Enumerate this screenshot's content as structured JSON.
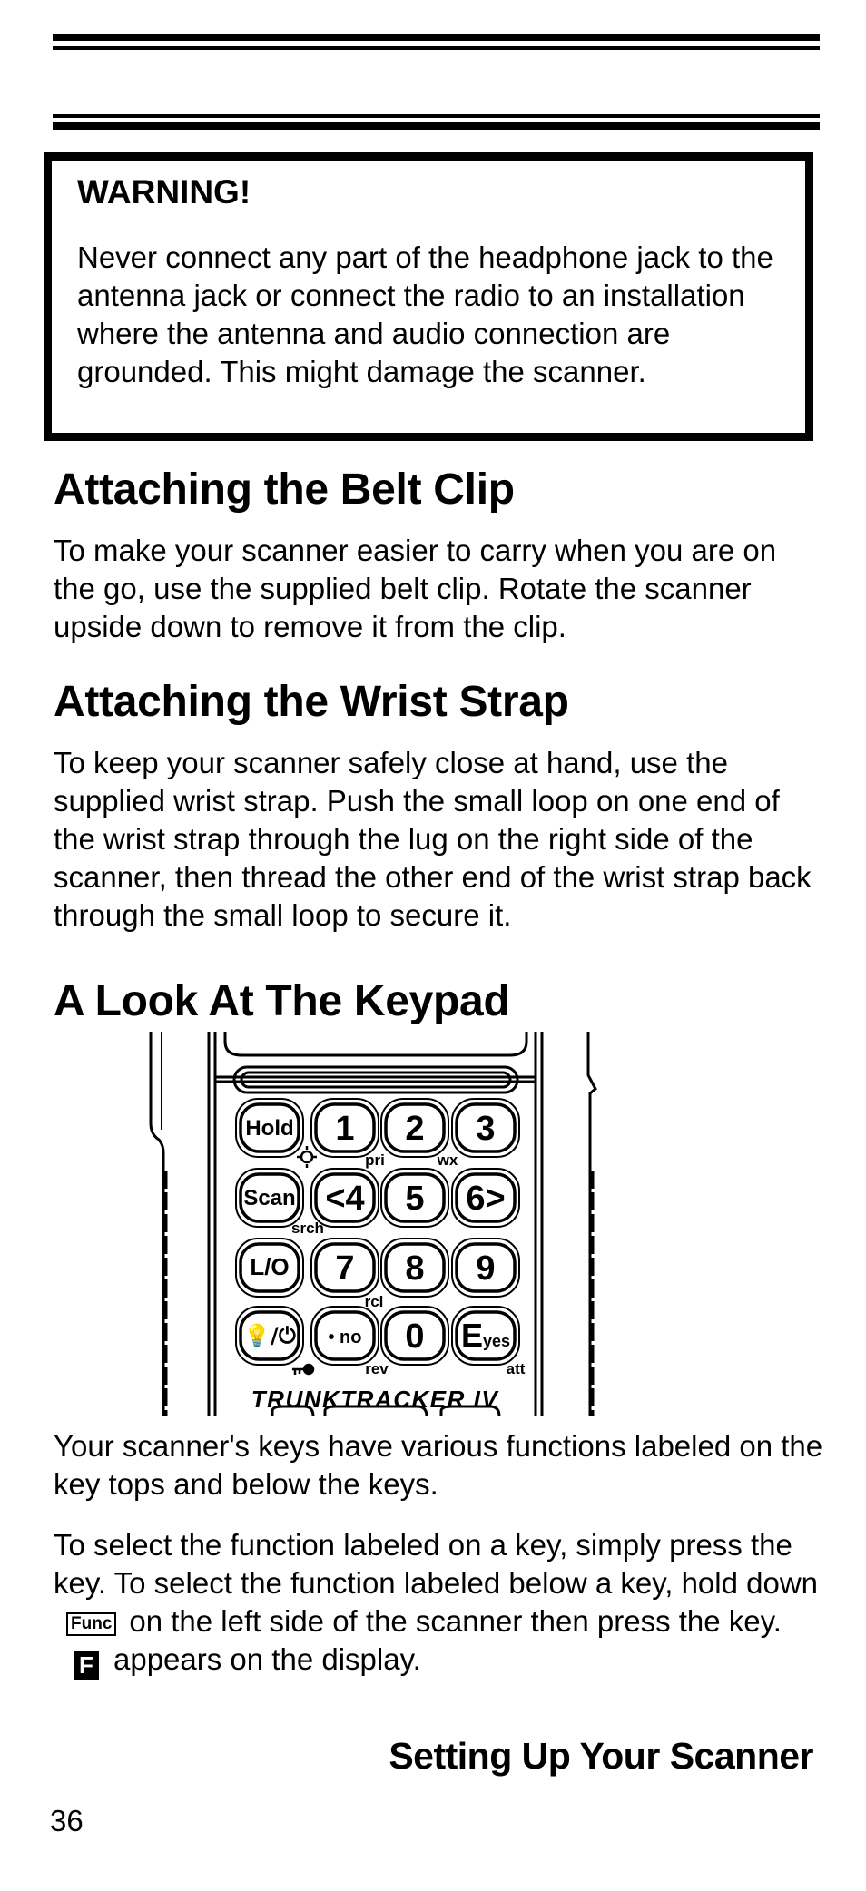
{
  "warning": {
    "title": "WARNING!",
    "body": "Never connect any part of the headphone jack to the antenna jack or connect the radio to an installation where the antenna and audio connection are grounded. This might damage the scanner."
  },
  "sections": [
    {
      "heading": "Attaching the Belt Clip",
      "text": "To make your scanner easier to carry when you are on the go, use the supplied belt clip. Rotate the scanner upside down to remove it from the clip."
    },
    {
      "heading": "Attaching the Wrist Strap",
      "text": "To keep your scanner safely close at hand, use the supplied wrist strap. Push the small loop on one end of the wrist strap through the lug on the right side of the scanner, then thread the other end of the wrist strap back through the small loop to secure it."
    },
    {
      "heading": "A Look At The Keypad"
    }
  ],
  "keypad": {
    "model": "TRUNKTRACKER IV",
    "keys": [
      [
        "Hold",
        "1",
        "2",
        "3"
      ],
      [
        "Scan",
        "<4",
        "5",
        "6>"
      ],
      [
        "L/O",
        "7",
        "8",
        "9"
      ],
      [
        "light/power",
        "• no",
        "0",
        "E yes"
      ]
    ],
    "sublabels": {
      "pri": "pri",
      "wx": "wx",
      "srch": "srch",
      "rcl": "rcl",
      "rev": "rev",
      "att": "att"
    }
  },
  "para1": "Your scanner's keys have various functions labeled on the key tops and below the keys.",
  "para2": {
    "part1": "To select the function labeled on a key, simply press the key. To select the function labeled below a key, hold down",
    "func_key": "Func",
    "part2": "on the left side of the scanner then press the key.",
    "f_icon": "F",
    "part3": "appears on the display."
  },
  "footer": {
    "section": "Setting Up Your Scanner",
    "page": "36"
  }
}
